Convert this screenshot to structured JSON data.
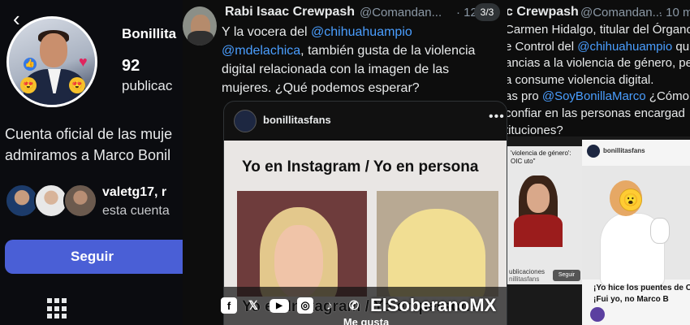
{
  "left_panel": {
    "back_glyph": "‹",
    "profile_name": "Bonillita",
    "post_count": "92",
    "post_label": "publicac",
    "bio_line1": "Cuenta oficial de las muje",
    "bio_line2": "admiramos a Marco Bonil",
    "followed_by": "valetg17, r",
    "followed_sub": "esta cuenta",
    "follow_button": "Seguir",
    "accent": "#4a5fd6"
  },
  "tweet": {
    "author": "Rabi Isaac Crewpash",
    "handle": "@Comandan...",
    "time": "· 12",
    "pager": "3/3",
    "text_1": "Y la vocera del ",
    "mention_1": "@chihuahuampio",
    "mention_2": "@mdelachica",
    "text_2": ", también gusta de la violencia digital relacionada con la imagen de las mujeres. ¿Qué podemos esperar?",
    "embed_user": "bonillitasfans",
    "embed_more": "•••",
    "meme_title": "Yo en Instagram / Yo en persona",
    "meme_title_repeat": "Yo en Instagram / Yo en persona",
    "meme_caption": "Me gusta",
    "mention_color": "#4a9eff"
  },
  "watermark": {
    "icons": [
      "facebook-icon",
      "x-icon",
      "youtube-icon",
      "instagram-icon",
      "tiktok-icon",
      "whatsapp-icon"
    ],
    "text": "ElSoberanoMX"
  },
  "right_panel": {
    "author": "c Crewpash",
    "handle": "@Comandan...",
    "time": "· 10 m",
    "line1": "Carmen Hidalgo, titular del Órgano",
    "line2a": "e Control del ",
    "line2_mention": "@chihuahuampio",
    "line2b": "   qu",
    "line3": "ancias a la violencia de género, per",
    "line4": "a consume violencia digital.",
    "line5a": "as pro ",
    "line5_mention": "@SoyBonillaMarco",
    "line5b": " ¿Cómo",
    "line6": " confiar en las personas encargad",
    "line7": "tituciones?",
    "news_headline": "'violencia de género': OIC\nuto\"",
    "news_pub": "ublicaciones",
    "news_user": "nillitasfans",
    "news_seguir": "Seguir",
    "post_user": "bonillitasfans",
    "post_caption_1": "¡Yo hice los puentes de C",
    "post_caption_2": "¡Fui yo, no Marco B"
  }
}
